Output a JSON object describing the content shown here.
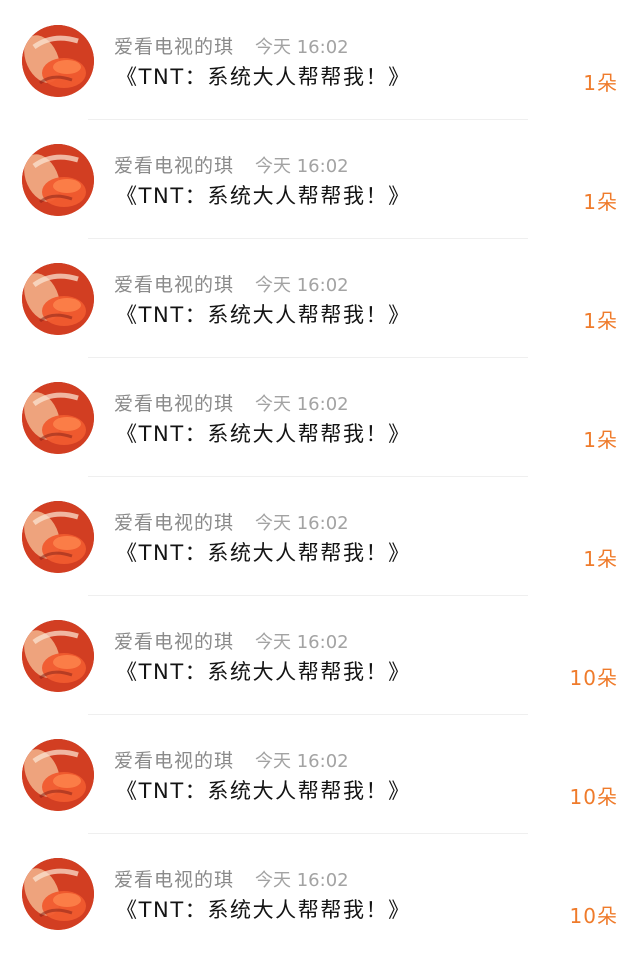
{
  "notifications": [
    {
      "username": "爱看电视的琪",
      "time": "今天 16:02",
      "message": "《TNT：系统大人帮帮我！》",
      "count": "1朵"
    },
    {
      "username": "爱看电视的琪",
      "time": "今天 16:02",
      "message": "《TNT：系统大人帮帮我！》",
      "count": "1朵"
    },
    {
      "username": "爱看电视的琪",
      "time": "今天 16:02",
      "message": "《TNT：系统大人帮帮我！》",
      "count": "1朵"
    },
    {
      "username": "爱看电视的琪",
      "time": "今天 16:02",
      "message": "《TNT：系统大人帮帮我！》",
      "count": "1朵"
    },
    {
      "username": "爱看电视的琪",
      "time": "今天 16:02",
      "message": "《TNT：系统大人帮帮我！》",
      "count": "1朵"
    },
    {
      "username": "爱看电视的琪",
      "time": "今天 16:02",
      "message": "《TNT：系统大人帮帮我！》",
      "count": "10朵"
    },
    {
      "username": "爱看电视的琪",
      "time": "今天 16:02",
      "message": "《TNT：系统大人帮帮我！》",
      "count": "10朵"
    },
    {
      "username": "爱看电视的琪",
      "time": "今天 16:02",
      "message": "《TNT：系统大人帮帮我！》",
      "count": "10朵"
    }
  ],
  "colors": {
    "username": "#8a8a8a",
    "time": "#a3a3a3",
    "message": "#141414",
    "count": "#ef7b2b",
    "divider": "#efefef"
  }
}
